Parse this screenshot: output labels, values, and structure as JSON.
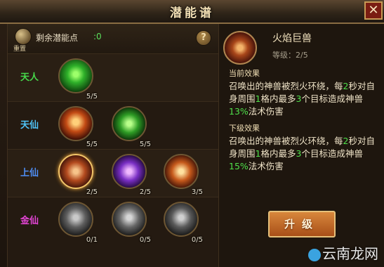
{
  "window": {
    "title": "潜能谱",
    "close_symbol": "✕"
  },
  "left_panel": {
    "reset_label": "重置",
    "points_label": "剩余潜能点",
    "points_value": ":0",
    "help_symbol": "?",
    "tiers": [
      {
        "label": "天人",
        "color": "#46d84a",
        "skills": [
          {
            "icon": "green-banner-icon",
            "count": "5/5"
          }
        ]
      },
      {
        "label": "天仙",
        "color": "#4fc3f7",
        "skills": [
          {
            "icon": "fire-skull-icon",
            "count": "5/5"
          },
          {
            "icon": "green-vortex-icon",
            "count": "5/5"
          }
        ]
      },
      {
        "label": "上仙",
        "color": "#4f8ff7",
        "skills": [
          {
            "icon": "fire-beast-icon",
            "count": "2/5"
          },
          {
            "icon": "purple-swirl-icon",
            "count": "2/5"
          },
          {
            "icon": "flame-skull-icon",
            "count": "3/5"
          }
        ]
      },
      {
        "label": "金仙",
        "color": "#e445d6",
        "skills": [
          {
            "icon": "grey-warrior-icon",
            "count": "0/1"
          },
          {
            "icon": "grey-giant-icon",
            "count": "0/5"
          },
          {
            "icon": "grey-shield-icon",
            "count": "0/5"
          }
        ]
      }
    ]
  },
  "detail": {
    "skill_name": "火焰巨兽",
    "level_text": "等级：2/5",
    "current_title": "当前效果",
    "current_desc": {
      "p1": "召唤出的神兽被烈火环绕，每",
      "n1": "2",
      "p2": "秒对自身周围",
      "n2": "1",
      "p3": "格内最多",
      "n3": "3",
      "p4": "个目标造成神兽",
      "n4": "13%",
      "p5": "法术伤害"
    },
    "next_title": "下级效果",
    "next_desc": {
      "p1": "召唤出的神兽被烈火环绕，每",
      "n1": "2",
      "p2": "秒对自身周围",
      "n2": "1",
      "p3": "格内最多",
      "n3": "3",
      "p4": "个目标造成神兽",
      "n4": "15%",
      "p5": "法术伤害"
    },
    "upgrade_label": "升级"
  },
  "watermark": "云南龙网"
}
